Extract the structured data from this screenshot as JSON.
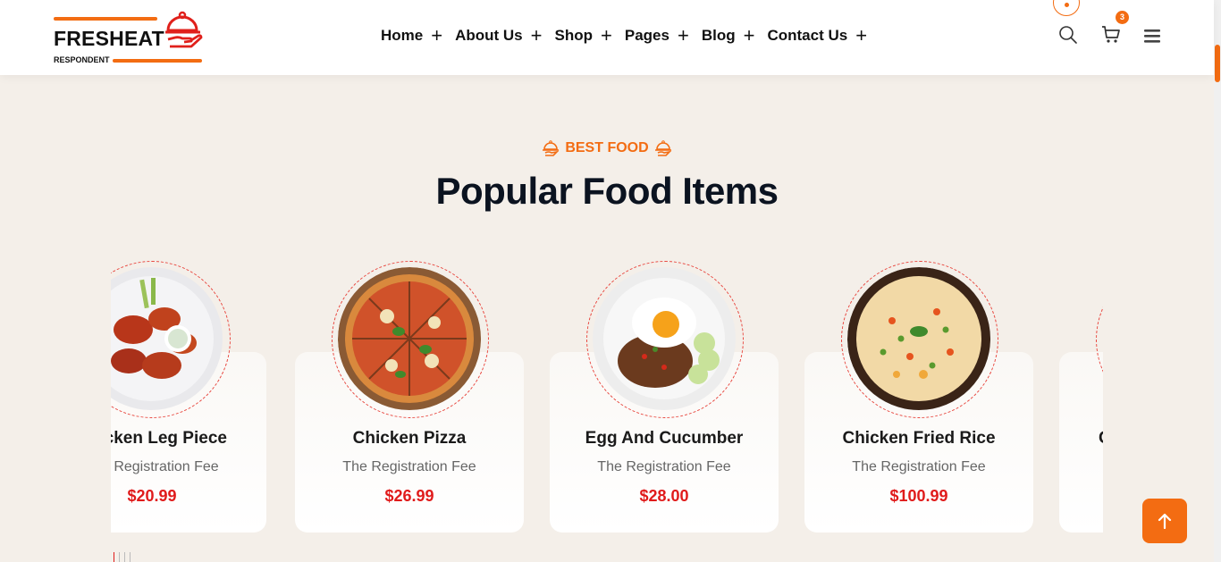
{
  "brand": {
    "name": "FRESHEAT",
    "tagline": "RESPONDENT"
  },
  "nav": [
    {
      "label": "Home"
    },
    {
      "label": "About Us"
    },
    {
      "label": "Shop"
    },
    {
      "label": "Pages"
    },
    {
      "label": "Blog"
    },
    {
      "label": "Contact Us"
    }
  ],
  "header_icons": {
    "search": "search-icon",
    "cart": "cart-icon",
    "menu": "hamburger-icon",
    "cart_count": "3"
  },
  "section": {
    "eyebrow": "BEST FOOD",
    "title": "Popular Food Items"
  },
  "products": [
    {
      "name": "Chicken Leg Piece",
      "desc": "The Registration Fee",
      "price": "$20.99"
    },
    {
      "name": "Chicken Pizza",
      "desc": "The Registration Fee",
      "price": "$26.99"
    },
    {
      "name": "Egg And Cucumber",
      "desc": "The Registration Fee",
      "price": "$28.00"
    },
    {
      "name": "Chicken Fried Rice",
      "desc": "The Registration Fee",
      "price": "$100.99"
    },
    {
      "name": "C",
      "desc": "",
      "price": ""
    }
  ],
  "colors": {
    "accent": "#f36c12",
    "price": "#e01b1b",
    "background": "#f4efe9",
    "heading": "#0b1320"
  },
  "back_to_top_icon": "arrow-up-icon"
}
